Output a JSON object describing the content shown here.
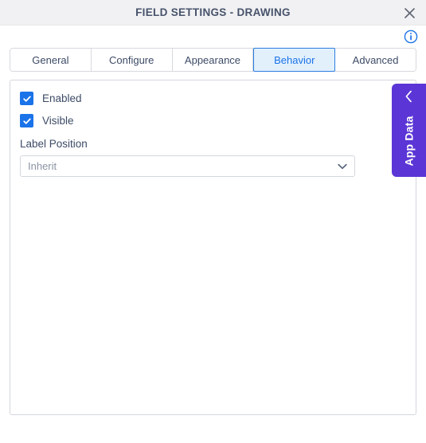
{
  "window": {
    "title": "FIELD SETTINGS - DRAWING",
    "close_icon": "close-icon"
  },
  "header": {
    "info_icon": "info-circle-icon"
  },
  "tabs": {
    "items": [
      {
        "label": "General",
        "active": false
      },
      {
        "label": "Configure",
        "active": false
      },
      {
        "label": "Appearance",
        "active": false
      },
      {
        "label": "Behavior",
        "active": true
      },
      {
        "label": "Advanced",
        "active": false
      }
    ]
  },
  "behavior_panel": {
    "enabled": {
      "label": "Enabled",
      "checked": true
    },
    "visible": {
      "label": "Visible",
      "checked": true
    },
    "label_position": {
      "label": "Label Position",
      "value": "Inherit",
      "chevron_icon": "chevron-down-icon"
    }
  },
  "app_data_tab": {
    "label": "App Data",
    "chevron_icon": "chevron-left-icon"
  },
  "colors": {
    "accent_blue": "#1a73e8",
    "active_tab_bg": "#e2f0fc",
    "app_data_purple": "#5b35d5",
    "title_text": "#47536b",
    "titlebar_bg": "#f1f1f3"
  }
}
